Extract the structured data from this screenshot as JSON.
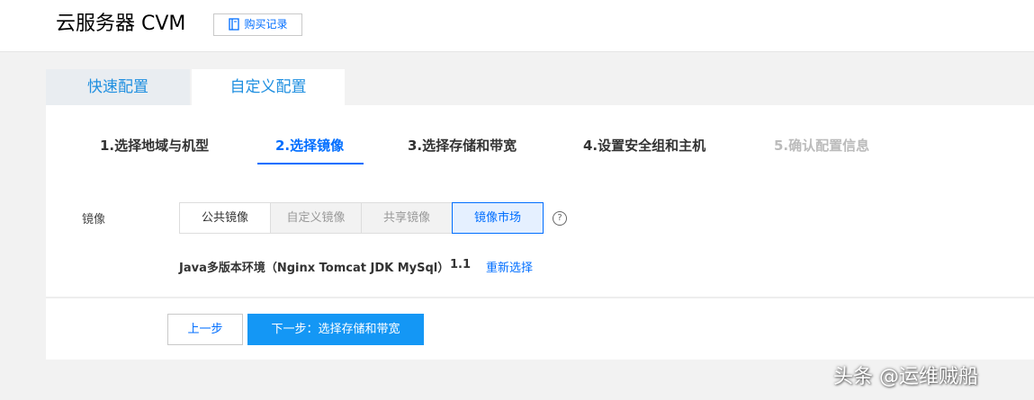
{
  "header": {
    "title": "云服务器 CVM",
    "purchase_record": "购买记录",
    "purchase_icon": "book-icon"
  },
  "tabs": [
    {
      "label": "快速配置",
      "active": false
    },
    {
      "label": "自定义配置",
      "active": true
    }
  ],
  "steps": [
    {
      "label": "1.选择地域与机型",
      "state": "done"
    },
    {
      "label": "2.选择镜像",
      "state": "active"
    },
    {
      "label": "3.选择存储和带宽",
      "state": "pending"
    },
    {
      "label": "4.设置安全组和主机",
      "state": "pending"
    },
    {
      "label": "5.确认配置信息",
      "state": "disabled"
    }
  ],
  "image_section": {
    "label": "镜像",
    "types": [
      {
        "label": "公共镜像"
      },
      {
        "label": "自定义镜像"
      },
      {
        "label": "共享镜像"
      },
      {
        "label": "镜像市场",
        "selected": true
      }
    ],
    "help": "?",
    "selected_image": "Java多版本环境（Nginx Tomcat JDK MySql）",
    "version": "1.1",
    "reselect": "重新选择"
  },
  "footer": {
    "prev": "上一步",
    "next": "下一步：选择存储和带宽"
  },
  "watermark": "头条 @运维贼船",
  "colors": {
    "accent": "#006eff",
    "primary_button": "#1497f5",
    "tab_inactive_bg": "#e9edf1",
    "page_bg": "#f2f2f2"
  }
}
